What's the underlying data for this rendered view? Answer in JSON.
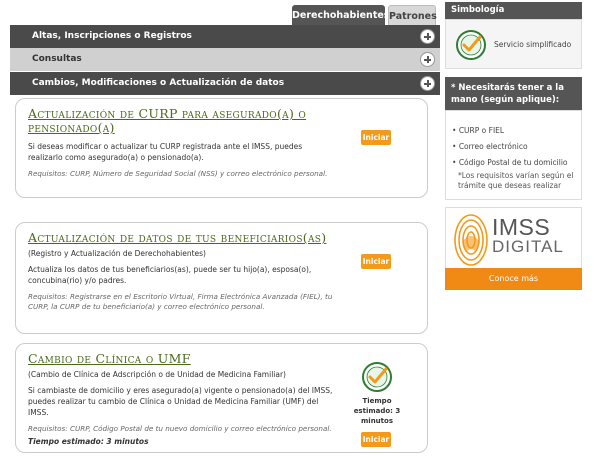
{
  "tabs": {
    "active": "Derechohabientes",
    "inactive": "Patrones"
  },
  "accordion": [
    {
      "label": "Altas, Inscripciones o Registros"
    },
    {
      "label": "Consultas"
    },
    {
      "label": "Cambios, Modificaciones o Actualización de datos"
    }
  ],
  "cards": [
    {
      "title": "Actualización de CURP para asegurado(a) o pensionado(a)",
      "description": "Si deseas modificar o actualizar tu CURP registrada ante el IMSS, puedes realizarlo como asegurado(a) o pensionado(a).",
      "requirements": "Requisitos: CURP, Número de Seguridad Social (NSS) y correo electrónico personal.",
      "button": "Iniciar"
    },
    {
      "title": "Actualización de datos de tus beneficiarios(as)",
      "subtitle": "(Registro y Actualización de Derechohabientes)",
      "description": "Actualiza los datos de tus beneficiarios(as), puede ser tu hijo(a), esposa(o), concubina(rio) y/o padres.",
      "requirements": "Requisitos: Registrarse en el Escritorio Virtual, Firma Electrónica Avanzada (FIEL), tu CURP, la CURP de tu beneficiario(a) y correo electrónico personal.",
      "button": "Iniciar"
    },
    {
      "title": "Cambio de Clínica o UMF",
      "subtitle": "(Cambio de Clínica de Adscripción o de Unidad de Medicina Familiar)",
      "description": "Si cambiaste de domicilio y eres asegurado(a) vigente o pensionado(a) del IMSS, puedes realizar tu cambio de Clínica o Unidad de Medicina Familiar (UMF) del IMSS.",
      "requirements": "Requisitos: CURP, Código Postal de tu nuevo domicilio y correo electrónico personal.",
      "time": "Tiempo estimado: 3 minutos",
      "seal_time": "Tiempo estimado: 3 minutos",
      "button": "Iniciar"
    }
  ],
  "sidebar": {
    "simbologia_title": "Simbología",
    "simbologia_text": "Servicio simplificado",
    "note_title": "* Necesitarás tener a la mano (según aplique):",
    "items": [
      "CURP o FIEL",
      "Correo electrónico",
      "Código Postal de tu domicilio"
    ],
    "extra": "*Los requisitos varían según el trámite que deseas realizar",
    "promo_imss": "IMSS",
    "promo_digital": "DIGITAL",
    "promo_button": "Conoce más"
  },
  "colors": {
    "accent_orange": "#f39a1a",
    "title_green": "#4a6a1a",
    "dark_bar": "#4a4a4a"
  }
}
